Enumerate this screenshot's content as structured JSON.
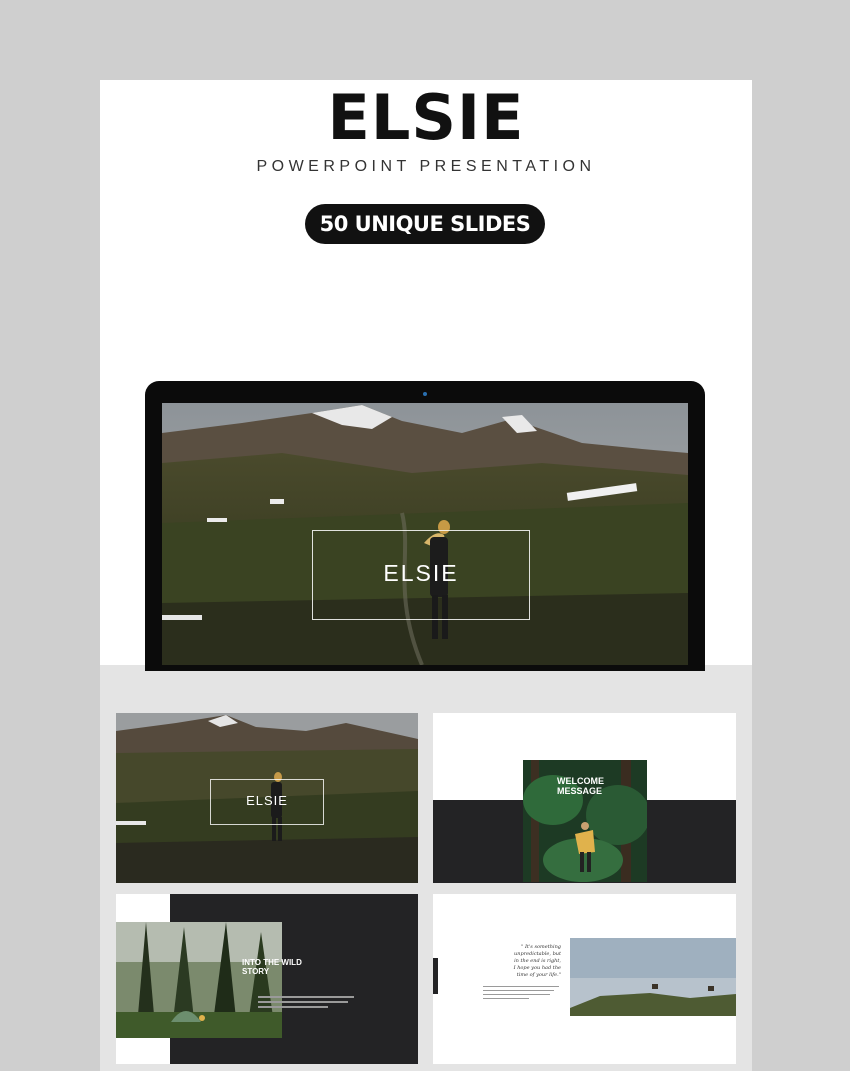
{
  "title": "ELSIE",
  "subtitle": "POWERPOINT PRESENTATION",
  "badge": "50 UNIQUE SLIDES",
  "hero": {
    "label": "ELSIE"
  },
  "slides": [
    {
      "label": "ELSIE"
    },
    {
      "label_line1": "WELCOME",
      "label_line2": "MESSAGE"
    },
    {
      "label_line1": "INTO THE WILD",
      "label_line2": "STORY"
    },
    {
      "quote_lines": [
        "\" It's something",
        "unpredictable, but",
        "in the end is right,",
        "I hope you had the",
        "time of your life.\""
      ]
    }
  ],
  "colors": {
    "background": "#cfcfcf",
    "card": "#ffffff",
    "dark": "#232325",
    "badge": "#111111"
  }
}
